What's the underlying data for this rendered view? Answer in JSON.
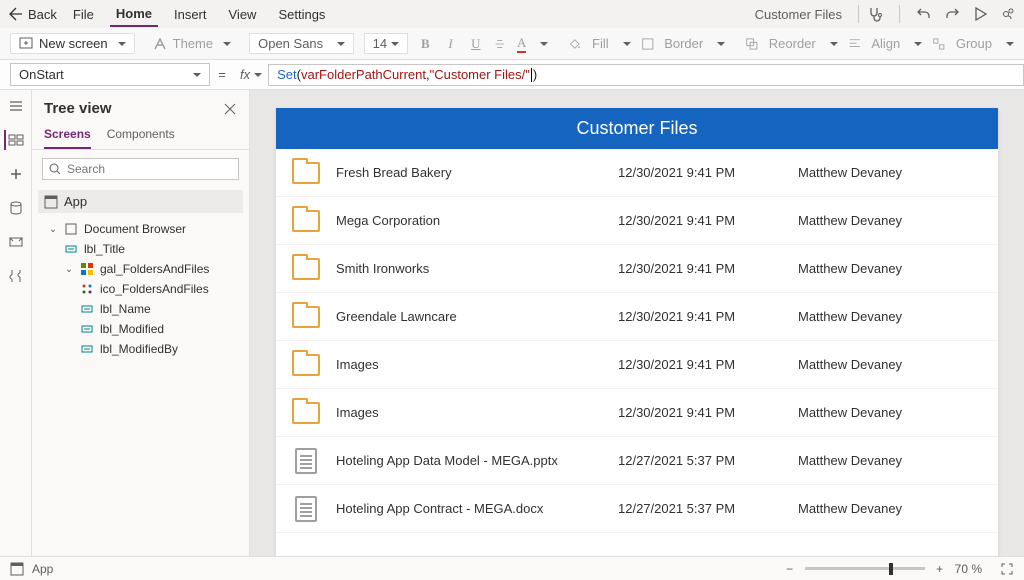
{
  "menu": {
    "back": "Back",
    "items": [
      "File",
      "Home",
      "Insert",
      "View",
      "Settings"
    ],
    "active_index": 1,
    "appname": "Customer Files"
  },
  "ribbon": {
    "newscreen": "New screen",
    "theme": "Theme",
    "font": "Open Sans",
    "size": "14",
    "fill": "Fill",
    "border": "Border",
    "reorder": "Reorder",
    "align": "Align",
    "group": "Group"
  },
  "formula": {
    "property": "OnStart",
    "fn": "Set",
    "arg1": "varFolderPathCurrent",
    "arg2": "\"Customer Files/\""
  },
  "tree": {
    "title": "Tree view",
    "tabs": [
      "Screens",
      "Components"
    ],
    "active_tab": 0,
    "search_placeholder": "Search",
    "appnode": "App",
    "nodes": {
      "screen": "Document Browser",
      "lbl_title": "lbl_Title",
      "gal": "gal_FoldersAndFiles",
      "ico": "ico_FoldersAndFiles",
      "lbl_name": "lbl_Name",
      "lbl_mod": "lbl_Modified",
      "lbl_modby": "lbl_ModifiedBy"
    }
  },
  "app": {
    "title": "Customer Files",
    "rows": [
      {
        "type": "folder",
        "name": "Fresh Bread Bakery",
        "modified": "12/30/2021 9:41 PM",
        "by": "Matthew Devaney"
      },
      {
        "type": "folder",
        "name": "Mega Corporation",
        "modified": "12/30/2021 9:41 PM",
        "by": "Matthew Devaney"
      },
      {
        "type": "folder",
        "name": "Smith Ironworks",
        "modified": "12/30/2021 9:41 PM",
        "by": "Matthew Devaney"
      },
      {
        "type": "folder",
        "name": "Greendale Lawncare",
        "modified": "12/30/2021 9:41 PM",
        "by": "Matthew Devaney"
      },
      {
        "type": "folder",
        "name": "Images",
        "modified": "12/30/2021 9:41 PM",
        "by": "Matthew Devaney"
      },
      {
        "type": "folder",
        "name": "Images",
        "modified": "12/30/2021 9:41 PM",
        "by": "Matthew Devaney"
      },
      {
        "type": "file",
        "name": "Hoteling App Data Model - MEGA.pptx",
        "modified": "12/27/2021 5:37 PM",
        "by": "Matthew Devaney"
      },
      {
        "type": "file",
        "name": "Hoteling App Contract - MEGA.docx",
        "modified": "12/27/2021 5:37 PM",
        "by": "Matthew Devaney"
      }
    ]
  },
  "status": {
    "app": "App",
    "zoom_percent": 70,
    "zoom_label": "70  %"
  }
}
